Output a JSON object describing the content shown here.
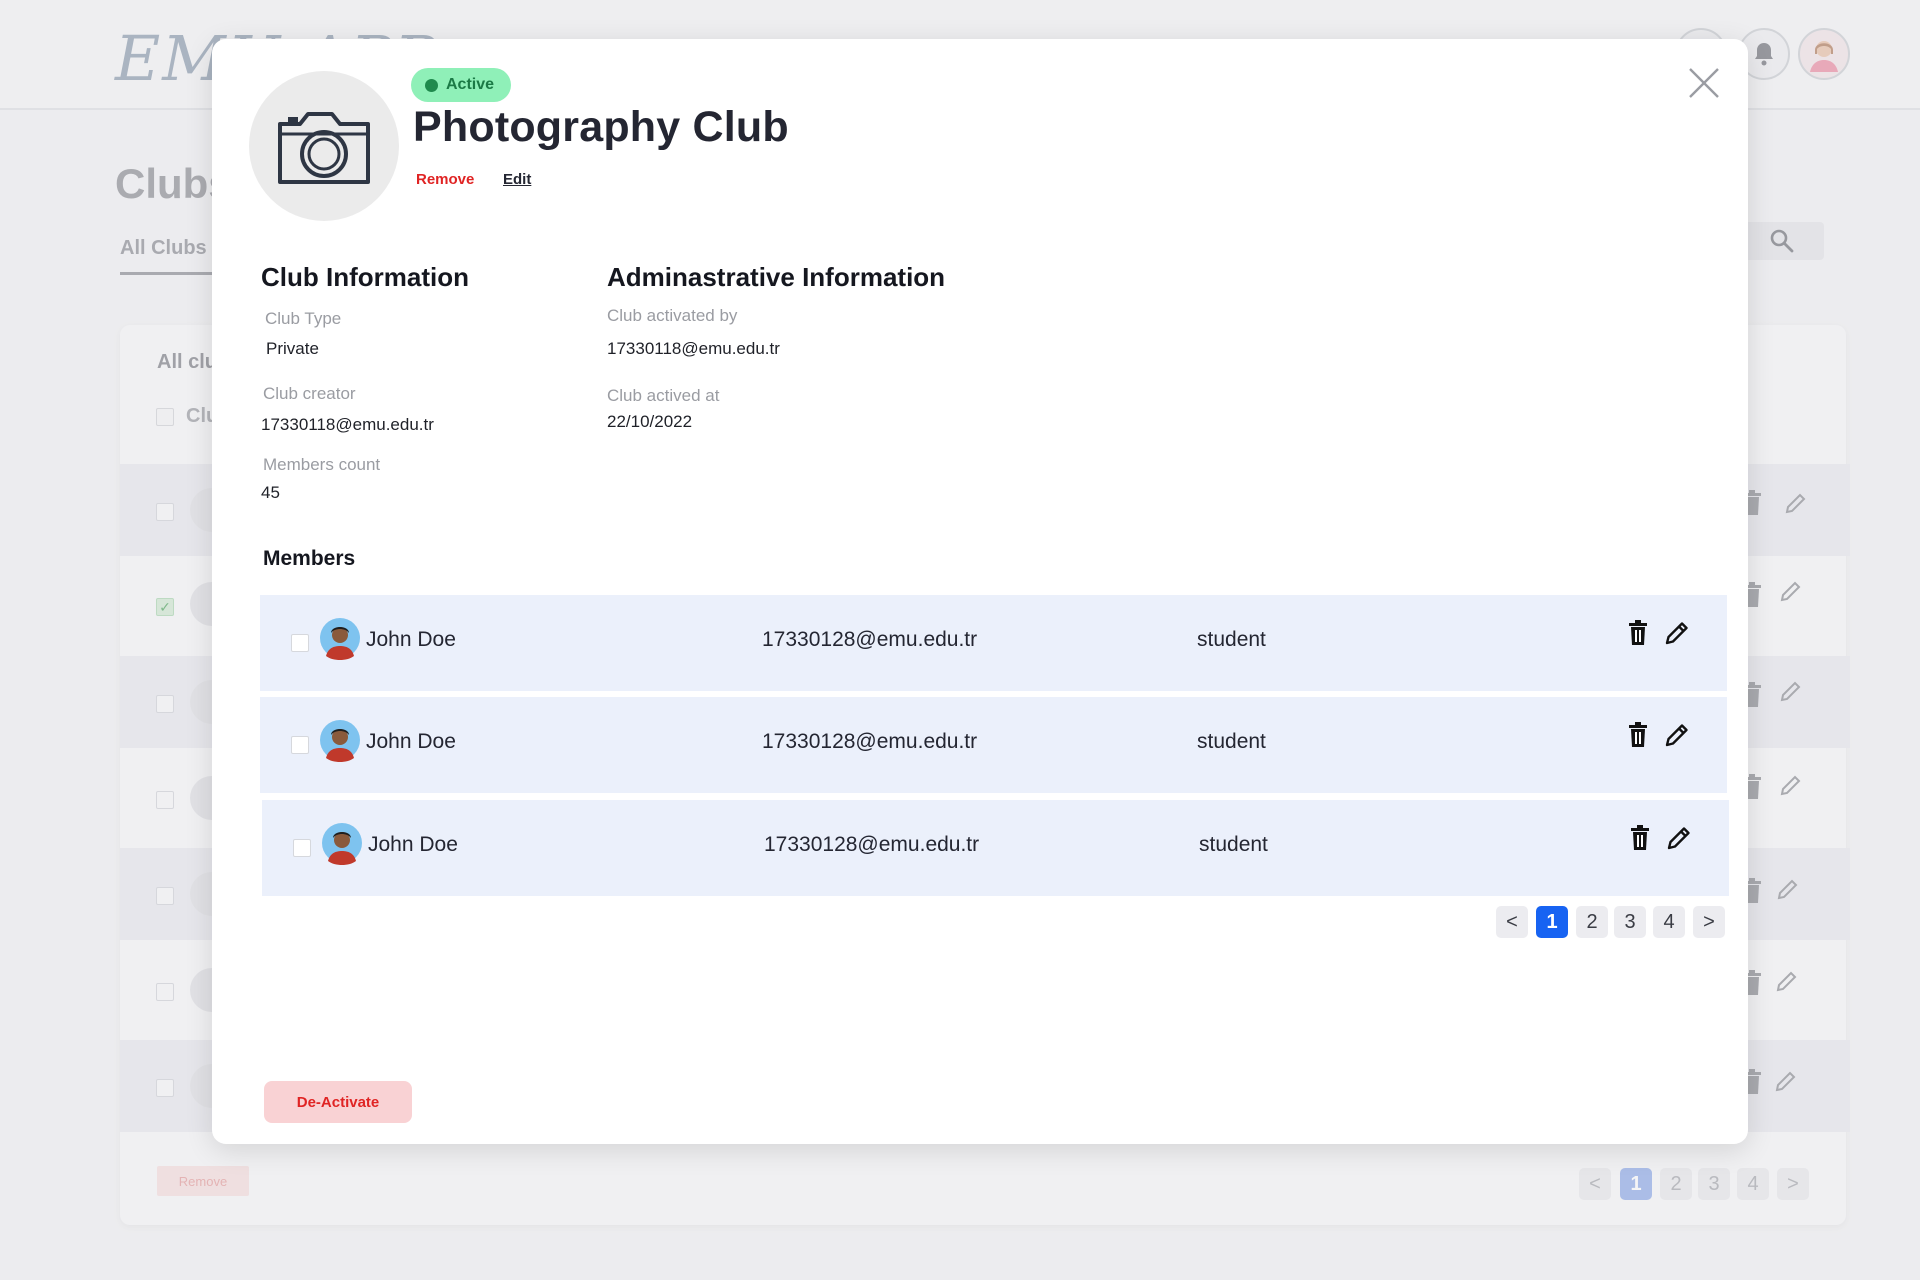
{
  "app": {
    "logo_text": "EMU APP"
  },
  "background": {
    "page_title": "Clubs",
    "tab_label": "All Clubs",
    "card_label": "All clu",
    "column_header": "Clu",
    "remove_label": "Remove",
    "pages": [
      "1",
      "2",
      "3",
      "4"
    ],
    "active_page": "1"
  },
  "modal": {
    "status": "Active",
    "title": "Photography Club",
    "remove_label": "Remove",
    "edit_label": "Edit",
    "club_info": {
      "heading": "Club Information",
      "type_label": "Club Type",
      "type_value": "Private",
      "creator_label": "Club creator",
      "creator_value": "17330118@emu.edu.tr",
      "members_label": "Members count",
      "members_value": "45"
    },
    "admin_info": {
      "heading": "Adminastrative Information",
      "activated_by_label": "Club activated by",
      "activated_by_value": "17330118@emu.edu.tr",
      "activated_at_label": "Club actived at",
      "activated_at_value": "22/10/2022"
    },
    "members": {
      "heading": "Members",
      "rows": [
        {
          "name": "John Doe",
          "email": "17330128@emu.edu.tr",
          "role": "student"
        },
        {
          "name": "John Doe",
          "email": "17330128@emu.edu.tr",
          "role": "student"
        },
        {
          "name": "John Doe",
          "email": "17330128@emu.edu.tr",
          "role": "student"
        }
      ]
    },
    "pagination": {
      "prev": "<",
      "pages": [
        "1",
        "2",
        "3",
        "4"
      ],
      "next": ">",
      "active": "1"
    },
    "deactivate_label": "De-Activate"
  },
  "colors": {
    "status_badge_bg": "#8ff0b8",
    "status_text": "#1b7a46",
    "danger": "#e02424",
    "row_bg": "#ebf0fb",
    "pager_active": "#1763f2"
  },
  "icons": [
    "camera-icon",
    "close-icon",
    "trash-icon",
    "pencil-icon",
    "search-icon",
    "bell-icon",
    "chevron-left-icon",
    "chevron-right-icon"
  ]
}
